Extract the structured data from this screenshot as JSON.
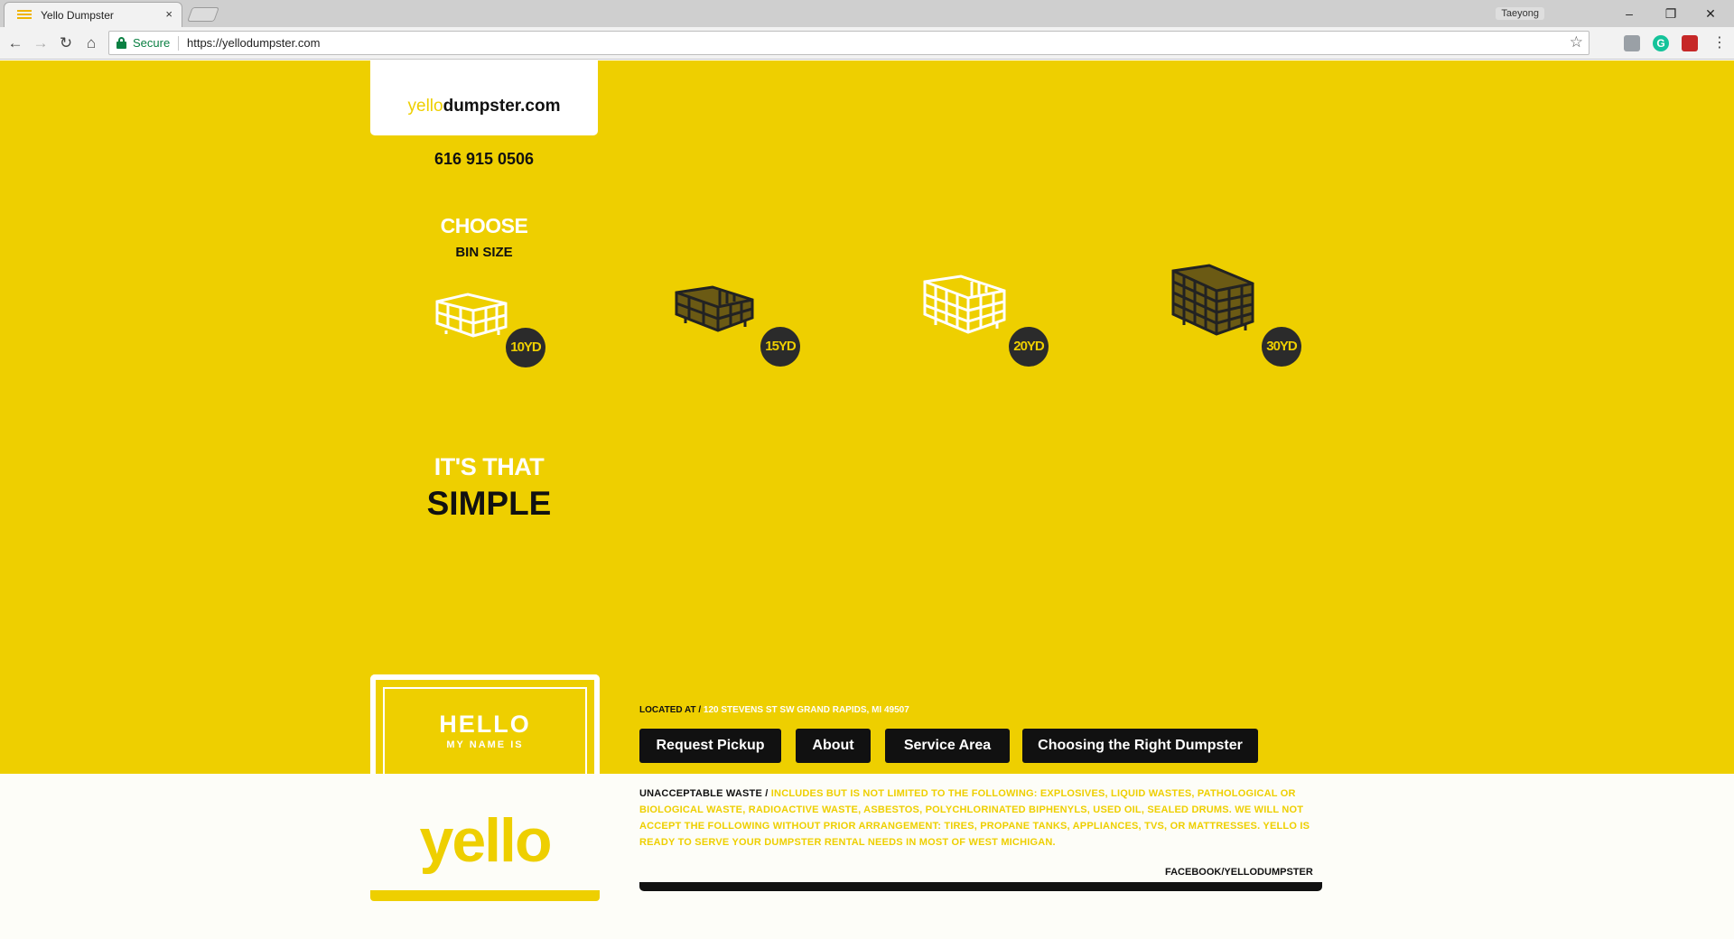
{
  "browser": {
    "tab_title": "Yello Dumpster",
    "tab_close": "×",
    "profile_name": "Taeyong",
    "secure_label": "Secure",
    "url": "https://yellodumpster.com",
    "window_buttons": {
      "minimize": "–",
      "restore": "❐",
      "close": "✕"
    }
  },
  "header": {
    "logo_prefix": "yello",
    "logo_suffix": "dumpster.com",
    "phone": "616 915 0506"
  },
  "chooser": {
    "title": "CHOOSE",
    "subtitle": "BIN SIZE",
    "bins": [
      {
        "label": "10YD",
        "style": "outline"
      },
      {
        "label": "15YD",
        "style": "filled"
      },
      {
        "label": "20YD",
        "style": "outline"
      },
      {
        "label": "30YD",
        "style": "filled"
      }
    ]
  },
  "tagline": {
    "line1": "IT'S THAT",
    "line2": "SIMPLE"
  },
  "nametag": {
    "hello": "HELLO",
    "my_name_is": "MY NAME IS",
    "name": "yello"
  },
  "footer": {
    "located_label": "LOCATED AT /",
    "address": "120 STEVENS ST SW GRAND RAPIDS, MI 49507",
    "nav": [
      "Request Pickup",
      "About",
      "Service Area",
      "Choosing the Right Dumpster"
    ],
    "waste_label": "UNACCEPTABLE WASTE /",
    "waste_text": "INCLUDES BUT IS NOT LIMITED TO THE FOLLOWING: EXPLOSIVES, LIQUID WASTES, PATHOLOGICAL OR BIOLOGICAL WASTE, RADIOACTIVE WASTE, ASBESTOS, POLYCHLORINATED BIPHENYLS, USED OIL, SEALED DRUMS. WE WILL NOT ACCEPT THE FOLLOWING WITHOUT PRIOR ARRANGEMENT: TIRES, PROPANE TANKS, APPLIANCES, TVS, OR MATTRESSES. YELLO IS READY TO SERVE YOUR DUMPSTER RENTAL NEEDS IN MOST OF WEST MICHIGAN.",
    "facebook": "FACEBOOK/YELLODUMPSTER"
  },
  "colors": {
    "brand_yellow": "#eecf00",
    "dark": "#111111",
    "badge": "#2b2b2b"
  }
}
